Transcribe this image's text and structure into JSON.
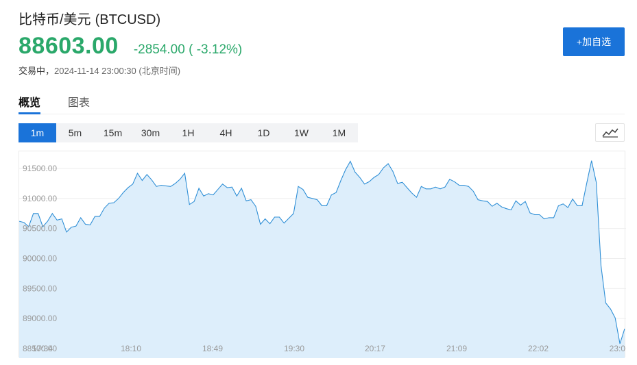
{
  "header": {
    "name": "比特币/美元",
    "symbol": "(BTCUSD)",
    "price": "88603.00",
    "change": "-2854.00 ( -3.12%)",
    "status": "交易中，",
    "timestamp": "2024-11-14 23:00:30 (北京时间)",
    "add_button": "+加自选"
  },
  "tabs": [
    {
      "label": "概览",
      "active": true
    },
    {
      "label": "图表",
      "active": false
    }
  ],
  "intervals": [
    {
      "label": "1m",
      "active": true
    },
    {
      "label": "5m",
      "active": false
    },
    {
      "label": "15m",
      "active": false
    },
    {
      "label": "30m",
      "active": false
    },
    {
      "label": "1H",
      "active": false
    },
    {
      "label": "4H",
      "active": false
    },
    {
      "label": "1D",
      "active": false
    },
    {
      "label": "1W",
      "active": false
    },
    {
      "label": "1M",
      "active": false
    }
  ],
  "chart_type_icon": "line-chart-icon",
  "colors": {
    "up_down": "#2aa86a",
    "accent": "#1a73d9",
    "line": "#2f8fd6",
    "area": "#ddeefb"
  },
  "chart_data": {
    "type": "area",
    "title": "",
    "xlabel": "",
    "ylabel": "",
    "ylim": [
      88500,
      91800
    ],
    "yticks": [
      "91500.00",
      "91000.00",
      "90500.00",
      "90000.00",
      "89500.00",
      "89000.00",
      "88500.00"
    ],
    "ytick_values": [
      91500,
      91000,
      90500,
      90000,
      89500,
      89000,
      88500
    ],
    "xticks": [
      "17:34",
      "18:10",
      "18:49",
      "19:30",
      "20:17",
      "21:09",
      "22:02",
      "23:0"
    ],
    "grid": true,
    "legend": "none",
    "values": [
      90620,
      90600,
      90530,
      90750,
      90750,
      90530,
      90620,
      90750,
      90640,
      90660,
      90440,
      90520,
      90540,
      90680,
      90570,
      90560,
      90700,
      90700,
      90840,
      90920,
      90930,
      91000,
      91100,
      91180,
      91240,
      91420,
      91300,
      91400,
      91310,
      91200,
      91220,
      91210,
      91200,
      91250,
      91320,
      91420,
      90900,
      90950,
      91170,
      91040,
      91080,
      91060,
      91150,
      91240,
      91180,
      91190,
      91040,
      91170,
      90960,
      90980,
      90870,
      90570,
      90660,
      90580,
      90690,
      90690,
      90590,
      90670,
      90750,
      91200,
      91150,
      91020,
      91000,
      90980,
      90880,
      90880,
      91060,
      91100,
      91300,
      91480,
      91620,
      91440,
      91350,
      91240,
      91280,
      91350,
      91400,
      91510,
      91580,
      91450,
      91250,
      91270,
      91180,
      91090,
      91020,
      91200,
      91160,
      91160,
      91190,
      91160,
      91190,
      91320,
      91280,
      91220,
      91220,
      91200,
      91120,
      90980,
      90960,
      90950,
      90870,
      90920,
      90860,
      90830,
      90810,
      90960,
      90890,
      90950,
      90760,
      90730,
      90730,
      90660,
      90680,
      90680,
      90880,
      90910,
      90850,
      90990,
      90880,
      90880,
      91260,
      91630,
      91270,
      89880,
      89260,
      89160,
      89010,
      88580,
      88830
    ]
  }
}
